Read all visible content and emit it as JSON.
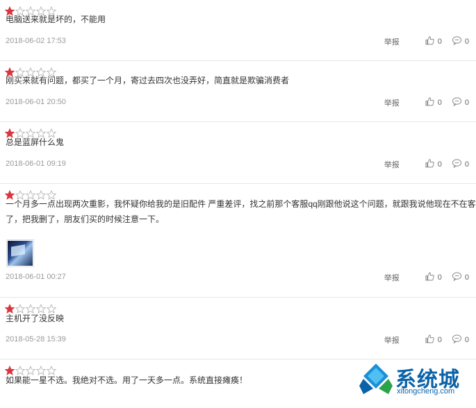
{
  "colors": {
    "star_filled": "#d9363e",
    "star_empty": "#bbbbbb",
    "text": "#333333",
    "meta": "#999999"
  },
  "icons": {
    "thumb": "thumbs-up-icon",
    "reply": "comment-icon",
    "star": "star-icon"
  },
  "reviews": [
    {
      "rating": 1,
      "max_rating": 5,
      "text_lines": [
        "电脑送来就是坏的，不能用"
      ],
      "date": "2018-06-02 17:53",
      "report": "举报",
      "likes": "0",
      "comments": "0",
      "has_image": false
    },
    {
      "rating": 1,
      "max_rating": 5,
      "text_lines": [
        "刚买来就有问题，都买了一个月，寄过去四次也没弄好，简直就是欺骗消费者"
      ],
      "date": "2018-06-01 20:50",
      "report": "举报",
      "likes": "0",
      "comments": "0",
      "has_image": false
    },
    {
      "rating": 1,
      "max_rating": 5,
      "text_lines": [
        "总是蓝屏什么鬼"
      ],
      "date": "2018-06-01 09:19",
      "report": "举报",
      "likes": "0",
      "comments": "0",
      "has_image": false
    },
    {
      "rating": 1,
      "max_rating": 5,
      "text_lines": [
        "一个月多一点出现两次重影，我怀疑你给我的是旧配件 严重差评，找之前那个客服qq刚跟他说这个问题，就跟我说他现在不在客服做",
        "了，把我删了，朋友们买的时候注意一下。"
      ],
      "date": "2018-06-01 00:27",
      "report": "举报",
      "likes": "0",
      "comments": "0",
      "has_image": true
    },
    {
      "rating": 1,
      "max_rating": 5,
      "text_lines": [
        "主机开了没反映"
      ],
      "date": "2018-05-28 15:39",
      "report": "举报",
      "likes": "0",
      "comments": "0",
      "has_image": false
    },
    {
      "rating": 1,
      "max_rating": 5,
      "text_lines": [
        "如果能一星不选。我绝对不选。用了一天多一点。系统直接瘫痪！"
      ],
      "date": "",
      "report": "",
      "likes": "",
      "comments": "",
      "has_image": false
    }
  ],
  "watermark": {
    "name_cn": "系统城",
    "name_en": "xitongcheng.com"
  }
}
